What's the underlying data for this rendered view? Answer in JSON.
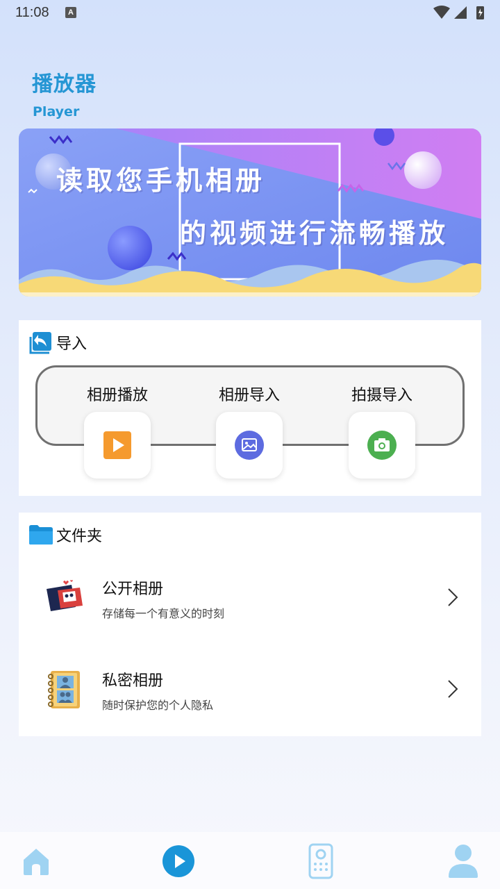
{
  "status_bar": {
    "time": "11:08",
    "notification_icon": "A"
  },
  "header": {
    "title": "播放器",
    "subtitle": "Player"
  },
  "banner": {
    "line1": "读取您手机相册",
    "line2": "的视频进行流畅播放"
  },
  "import_section": {
    "title": "导入",
    "icon": "import-arrow-icon",
    "actions": [
      {
        "label": "相册播放",
        "icon": "play-icon",
        "color": "#f59a2e"
      },
      {
        "label": "相册导入",
        "icon": "image-icon",
        "color": "#5d6be0"
      },
      {
        "label": "拍摄导入",
        "icon": "camera-icon",
        "color": "#4caf50"
      }
    ]
  },
  "folder_section": {
    "title": "文件夹",
    "icon": "folder-icon",
    "items": [
      {
        "name": "公开相册",
        "description": "存储每一个有意义的时刻",
        "icon": "photo-album-icon"
      },
      {
        "name": "私密相册",
        "description": "随时保护您的个人隐私",
        "icon": "contact-book-icon"
      }
    ]
  },
  "bottom_nav": {
    "items": [
      {
        "name": "home",
        "icon": "home-icon"
      },
      {
        "name": "player",
        "icon": "play-circle-icon"
      },
      {
        "name": "remote",
        "icon": "remote-icon"
      },
      {
        "name": "profile",
        "icon": "user-icon"
      }
    ],
    "active_color": "#1a95d8",
    "inactive_color": "#9fd3f2"
  },
  "colors": {
    "accent": "#2596d4",
    "banner_blue": "#7f97f3",
    "banner_purple": "#c381f6",
    "banner_yellow": "#f7d977"
  }
}
